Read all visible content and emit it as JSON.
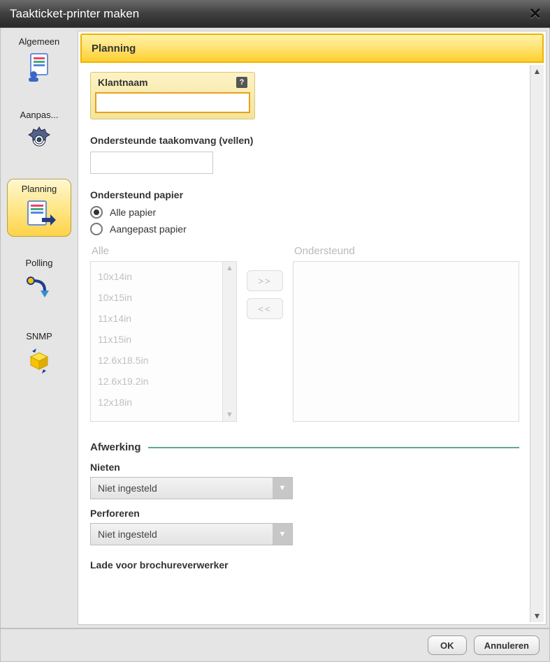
{
  "window": {
    "title": "Taakticket-printer maken"
  },
  "sidebar": {
    "items": [
      {
        "label": "Algemeen"
      },
      {
        "label": "Aanpas..."
      },
      {
        "label": "Planning"
      },
      {
        "label": "Polling"
      },
      {
        "label": "SNMP"
      }
    ],
    "active_index": 2
  },
  "panel": {
    "title": "Planning"
  },
  "klantnaam": {
    "label": "Klantnaam",
    "value": ""
  },
  "taakomvang": {
    "label": "Ondersteunde taakomvang (vellen)",
    "value": ""
  },
  "papier": {
    "label": "Ondersteund papier",
    "options": {
      "all": "Alle papier",
      "custom": "Aangepast papier"
    },
    "selected": "all",
    "columns": {
      "all": "Alle",
      "supported": "Ondersteund"
    },
    "all_list": [
      "10x14in",
      "10x15in",
      "11x14in",
      "11x15in",
      "12.6x18.5in",
      "12.6x19.2in",
      "12x18in"
    ],
    "supported_list": [],
    "move": {
      "right": ">>",
      "left": "<<"
    }
  },
  "afwerking": {
    "title": "Afwerking",
    "nieten": {
      "label": "Nieten",
      "value": "Niet ingesteld"
    },
    "perforeren": {
      "label": "Perforeren",
      "value": "Niet ingesteld"
    },
    "lade": {
      "label": "Lade voor brochureverwerker"
    }
  },
  "footer": {
    "ok": "OK",
    "cancel": "Annuleren"
  }
}
